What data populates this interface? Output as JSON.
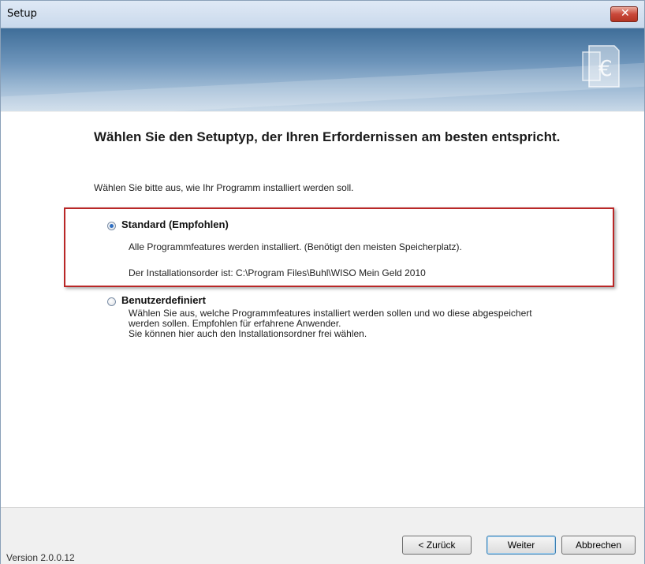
{
  "window": {
    "title": "Setup",
    "close_label": "✕"
  },
  "content": {
    "heading": "Wählen Sie den Setuptyp, der Ihren Erfordernissen am besten entspricht.",
    "subtitle": "Wählen Sie bitte aus, wie Ihr Programm installiert werden soll.",
    "options": [
      {
        "label": "Standard (Empfohlen)",
        "selected": true,
        "lines": [
          "Alle Programmfeatures werden installiert. (Benötigt den meisten Speicherplatz).",
          "Der Installationsorder ist: C:\\Program Files\\Buhl\\WISO Mein Geld 2010"
        ]
      },
      {
        "label": "Benutzerdefiniert",
        "selected": false,
        "lines": [
          "Wählen Sie aus, welche Programmfeatures installiert werden sollen und wo diese abgespeichert",
          "werden sollen. Empfohlen für erfahrene Anwender.",
          "Sie können hier auch den Installationsordner frei wählen."
        ]
      }
    ]
  },
  "footer": {
    "version": "Version 2.0.0.12",
    "back_label": "< Zurück",
    "next_label": "Weiter",
    "cancel_label": "Abbrechen"
  },
  "colors": {
    "highlight": "#b92727",
    "banner": "#6e95bb",
    "radio_selected": "#2f6fc2"
  },
  "icons": {
    "logo": "euro-document-icon",
    "close": "close-icon"
  }
}
